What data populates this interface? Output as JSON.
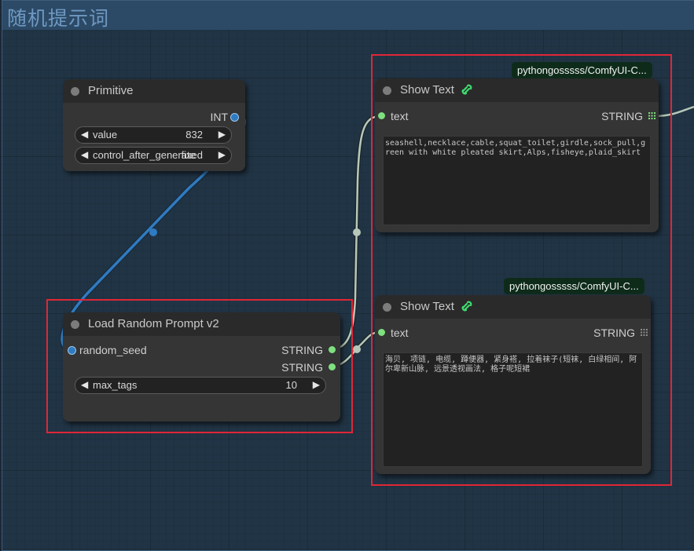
{
  "group": {
    "title": "随机提示词"
  },
  "primitive": {
    "title": "Primitive",
    "output_label": "INT",
    "value_label": "value",
    "value": "832",
    "control_label": "control_after_generate",
    "control_value": "fixed"
  },
  "load_random_prompt": {
    "title": "Load Random Prompt v2",
    "input_label": "random_seed",
    "output1_label": "STRING",
    "output2_label": "STRING",
    "max_tags_label": "max_tags",
    "max_tags_value": "10"
  },
  "show_text_1": {
    "tag": "pythongosssss/ComfyUI-C...",
    "title": "Show Text",
    "input_label": "text",
    "output_label": "STRING",
    "content": "seashell,necklace,cable,squat_toilet,girdle,sock_pull,green with white pleated skirt,Alps,fisheye,plaid_skirt"
  },
  "show_text_2": {
    "tag": "pythongosssss/ComfyUI-C...",
    "title": "Show Text",
    "input_label": "text",
    "output_label": "STRING",
    "content": "海贝, 项链, 电缆, 蹲便器, 紧身褡, 拉着袜子(短袜, 白绿相间, 阿尔卑新山脉, 远景透视画法, 格子呢短裙"
  },
  "colors": {
    "int_link": "#2f7bc1",
    "string_link": "#b6c8b8",
    "slot_green": "#7fe07f",
    "highlight": "#e02637",
    "tag_bg": "#0e2b1a"
  },
  "icons": [
    "link-icon",
    "grid-icon",
    "arrow-left-icon",
    "arrow-right-icon"
  ]
}
